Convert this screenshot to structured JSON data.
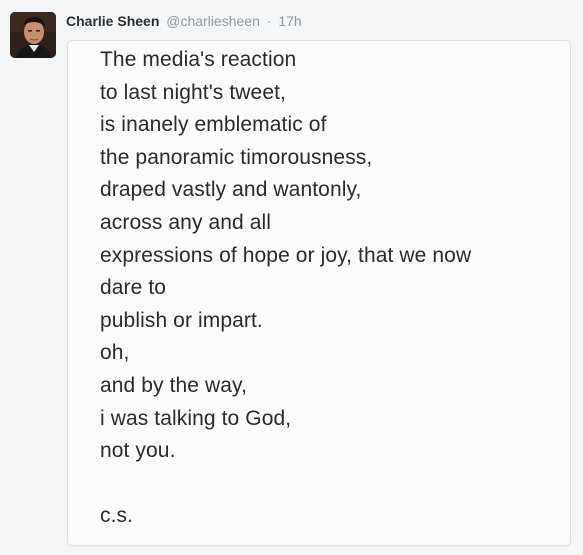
{
  "tweet": {
    "display_name": "Charlie Sheen",
    "handle": "@charliesheen",
    "separator": "·",
    "timestamp": "17h",
    "avatar_icon": "profile-photo",
    "note_lines": [
      "The media's reaction",
      "to last night's tweet,",
      "is inanely emblematic of",
      "the panoramic timorousness,",
      "draped vastly and wantonly,",
      "across any and all",
      "expressions of hope or joy, that we now",
      "dare to",
      "publish or impart.",
      "oh,",
      "and by the way,",
      "i was talking to God,",
      "not you.",
      "",
      "c.s."
    ]
  },
  "colors": {
    "page_background": "#f4f5f7",
    "card_background": "#fbfbfb",
    "card_border": "#dcdfe3",
    "name_text": "#292f33",
    "meta_text": "#8899a6",
    "note_text": "#2a2a2a"
  }
}
